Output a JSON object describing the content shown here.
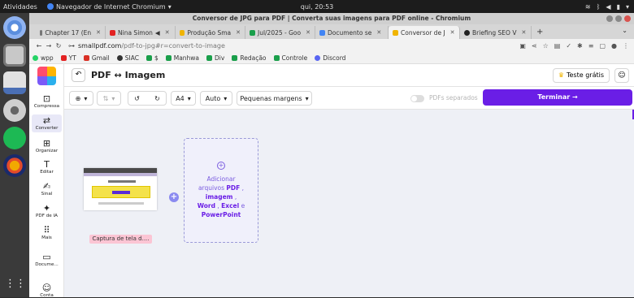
{
  "topbar": {
    "activities": "Atividades",
    "app_name": "Navegador de Internet Chromium",
    "clock": "qui, 20:53"
  },
  "window": {
    "title": "Conversor de JPG para PDF | Converta suas imagens para PDF online - Chromium"
  },
  "tabs": [
    {
      "label": "Chapter 17 (En",
      "color": "#777777"
    },
    {
      "label": "Nina Simon",
      "color": "#e32222"
    },
    {
      "label": "Produção Sma",
      "color": "#f0b400"
    },
    {
      "label": "Jul/2025 - Goo",
      "color": "#1a9f4b"
    },
    {
      "label": "Documento se",
      "color": "#4285f4"
    },
    {
      "label": "Conversor de J",
      "color": "#f0b400",
      "active": true
    },
    {
      "label": "Briefing SEO V",
      "color": "#222222"
    }
  ],
  "address": {
    "host": "smallpdf.com",
    "path": "/pdf-to-jpg#r=convert-to-image"
  },
  "bookmarks": [
    {
      "label": "wpp",
      "color": "#25d366"
    },
    {
      "label": "YT",
      "color": "#e32222"
    },
    {
      "label": "Gmail",
      "color": "#d93025"
    },
    {
      "label": "SIAC",
      "color": "#333333"
    },
    {
      "label": "$",
      "color": "#1a9f4b"
    },
    {
      "label": "Manhwa",
      "color": "#1a9f4b"
    },
    {
      "label": "Div",
      "color": "#1a9f4b"
    },
    {
      "label": "Redação",
      "color": "#1a9f4b"
    },
    {
      "label": "Controle",
      "color": "#1a9f4b"
    },
    {
      "label": "Discord",
      "color": "#5865f2"
    }
  ],
  "sidebar": {
    "items": [
      {
        "label": "Compressa",
        "icon": "compress-icon"
      },
      {
        "label": "Converter",
        "icon": "convert-icon",
        "active": true
      },
      {
        "label": "Organizar",
        "icon": "organize-icon"
      },
      {
        "label": "Editar",
        "icon": "edit-icon"
      },
      {
        "label": "Sinal",
        "icon": "sign-icon"
      },
      {
        "label": "PDF de IA",
        "icon": "ai-icon"
      },
      {
        "label": "Mais",
        "icon": "more-icon"
      },
      {
        "label": "Docume...",
        "icon": "documents-icon"
      },
      {
        "label": "Conta",
        "icon": "account-icon"
      }
    ]
  },
  "header": {
    "title": "PDF ↔ Imagem",
    "trial": "Teste grátis"
  },
  "toolbar": {
    "page_size": "A4",
    "orientation": "Auto",
    "margins": "Pequenas margens",
    "toggle_label": "PDFs separados",
    "finish": "Terminar →"
  },
  "file": {
    "name": "Captura de tela d...."
  },
  "dropzone": {
    "line1": "Adicionar",
    "line2": "arquivos",
    "pdf": "PDF",
    "image": "imagem",
    "word": "Word",
    "excel": "Excel",
    "e": "e",
    "ppt": "PowerPoint"
  },
  "colors": {
    "accent": "#6a1ee6",
    "file_label_bg": "#fbc5d4"
  }
}
